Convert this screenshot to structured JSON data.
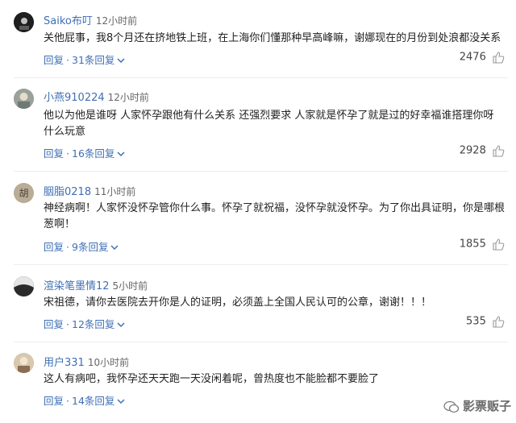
{
  "comments": [
    {
      "user": "Saiko布叮",
      "time": "12小时前",
      "text": "关他屁事，我8个月还在挤地铁上班，在上海你们懂那种早高峰嘛，谢娜现在的月份到处浪都没关系",
      "reply_label": "回复",
      "replies_label": "31条回复",
      "likes": "2476",
      "avatar_color": "#1e1e1e"
    },
    {
      "user": "小燕910224",
      "time": "12小时前",
      "text": "他以为他是谁呀 人家怀孕跟他有什么关系 还强烈要求 人家就是怀孕了就是过的好幸福谁搭理你呀 什么玩意",
      "reply_label": "回复",
      "replies_label": "16条回复",
      "likes": "2928",
      "avatar_color": "#8a8f86"
    },
    {
      "user": "胭脂0218",
      "time": "11小时前",
      "text": "神经病啊！人家怀没怀孕管你什么事。怀孕了就祝福，没怀孕就没怀孕。为了你出具证明，你是哪根葱啊！",
      "reply_label": "回复",
      "replies_label": "9条回复",
      "likes": "1855",
      "avatar_color": "#b5aa98",
      "avatar_glyph": "胡"
    },
    {
      "user": "渲染笔墨情12",
      "time": "5小时前",
      "text": "宋祖德，请你去医院去开你是人的证明，必须盖上全国人民认可的公章，谢谢！！！",
      "reply_label": "回复",
      "replies_label": "12条回复",
      "likes": "535",
      "avatar_color": "#3a3a3a"
    },
    {
      "user": "用户331",
      "time": "10小时前",
      "text": "这人有病吧，我怀孕还天天跑一天没闲着呢，曾热度也不能脸都不要脸了",
      "reply_label": "回复",
      "replies_label": "14条回复",
      "likes": "",
      "avatar_color": "#c9b79a"
    }
  ],
  "watermark": "影票贩子",
  "colors": {
    "link": "#3f6fb5",
    "text": "#222222",
    "divider": "#ececec"
  }
}
